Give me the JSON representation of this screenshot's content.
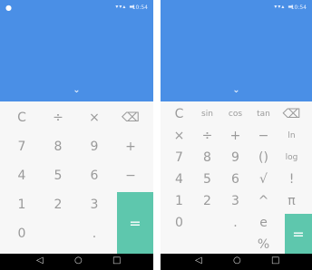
{
  "status": {
    "left_icon": "●",
    "signal": "▾▾▴ ▬",
    "time": "10:54"
  },
  "display": {
    "chevron": "⌄"
  },
  "left": {
    "keys": [
      {
        "label": "C",
        "row": 0,
        "col": 0
      },
      {
        "label": "÷",
        "row": 0,
        "col": 1
      },
      {
        "label": "×",
        "row": 0,
        "col": 2
      },
      {
        "label": "⌫",
        "row": 0,
        "col": 3
      },
      {
        "label": "7",
        "row": 1,
        "col": 0
      },
      {
        "label": "8",
        "row": 1,
        "col": 1
      },
      {
        "label": "9",
        "row": 1,
        "col": 2
      },
      {
        "label": "+",
        "row": 1,
        "col": 3
      },
      {
        "label": "4",
        "row": 2,
        "col": 0
      },
      {
        "label": "5",
        "row": 2,
        "col": 1
      },
      {
        "label": "6",
        "row": 2,
        "col": 2
      },
      {
        "label": "−",
        "row": 2,
        "col": 3
      },
      {
        "label": "1",
        "row": 3,
        "col": 0
      },
      {
        "label": "2",
        "row": 3,
        "col": 1
      },
      {
        "label": "3",
        "row": 3,
        "col": 2
      },
      {
        "label": "0",
        "row": 4,
        "col": 0
      },
      {
        "label": ".",
        "row": 4,
        "col": 2
      }
    ],
    "equals": "="
  },
  "right": {
    "keys": [
      {
        "label": "C",
        "row": 0,
        "col": 0
      },
      {
        "label": "sin",
        "row": 0,
        "col": 1
      },
      {
        "label": "cos",
        "row": 0,
        "col": 2
      },
      {
        "label": "tan",
        "row": 0,
        "col": 3
      },
      {
        "label": "⌫",
        "row": 0,
        "col": 4
      },
      {
        "label": "×",
        "row": 1,
        "col": 0
      },
      {
        "label": "÷",
        "row": 1,
        "col": 1
      },
      {
        "label": "+",
        "row": 1,
        "col": 2
      },
      {
        "label": "−",
        "row": 1,
        "col": 3
      },
      {
        "label": "ln",
        "row": 1,
        "col": 4
      },
      {
        "label": "7",
        "row": 2,
        "col": 0
      },
      {
        "label": "8",
        "row": 2,
        "col": 1
      },
      {
        "label": "9",
        "row": 2,
        "col": 2
      },
      {
        "label": "()",
        "row": 2,
        "col": 3
      },
      {
        "label": "log",
        "row": 2,
        "col": 4
      },
      {
        "label": "4",
        "row": 3,
        "col": 0
      },
      {
        "label": "5",
        "row": 3,
        "col": 1
      },
      {
        "label": "6",
        "row": 3,
        "col": 2
      },
      {
        "label": "√",
        "row": 3,
        "col": 3
      },
      {
        "label": "!",
        "row": 3,
        "col": 4
      },
      {
        "label": "1",
        "row": 4,
        "col": 0
      },
      {
        "label": "2",
        "row": 4,
        "col": 1
      },
      {
        "label": "3",
        "row": 4,
        "col": 2
      },
      {
        "label": "^",
        "row": 4,
        "col": 3
      },
      {
        "label": "π",
        "row": 4,
        "col": 4
      },
      {
        "label": "0",
        "row": 5,
        "col": 0
      },
      {
        "label": ".",
        "row": 5,
        "col": 2
      },
      {
        "label": "e",
        "row": 5,
        "col": 3
      },
      {
        "label": "%",
        "row": 6,
        "col": 3
      }
    ],
    "equals": "="
  },
  "navbar": {
    "back": "◁",
    "home": "○",
    "recents": "□"
  },
  "colors": {
    "display": "#4a8fe6",
    "equals": "#5ec7ad",
    "keypad": "#f7f7f7"
  }
}
